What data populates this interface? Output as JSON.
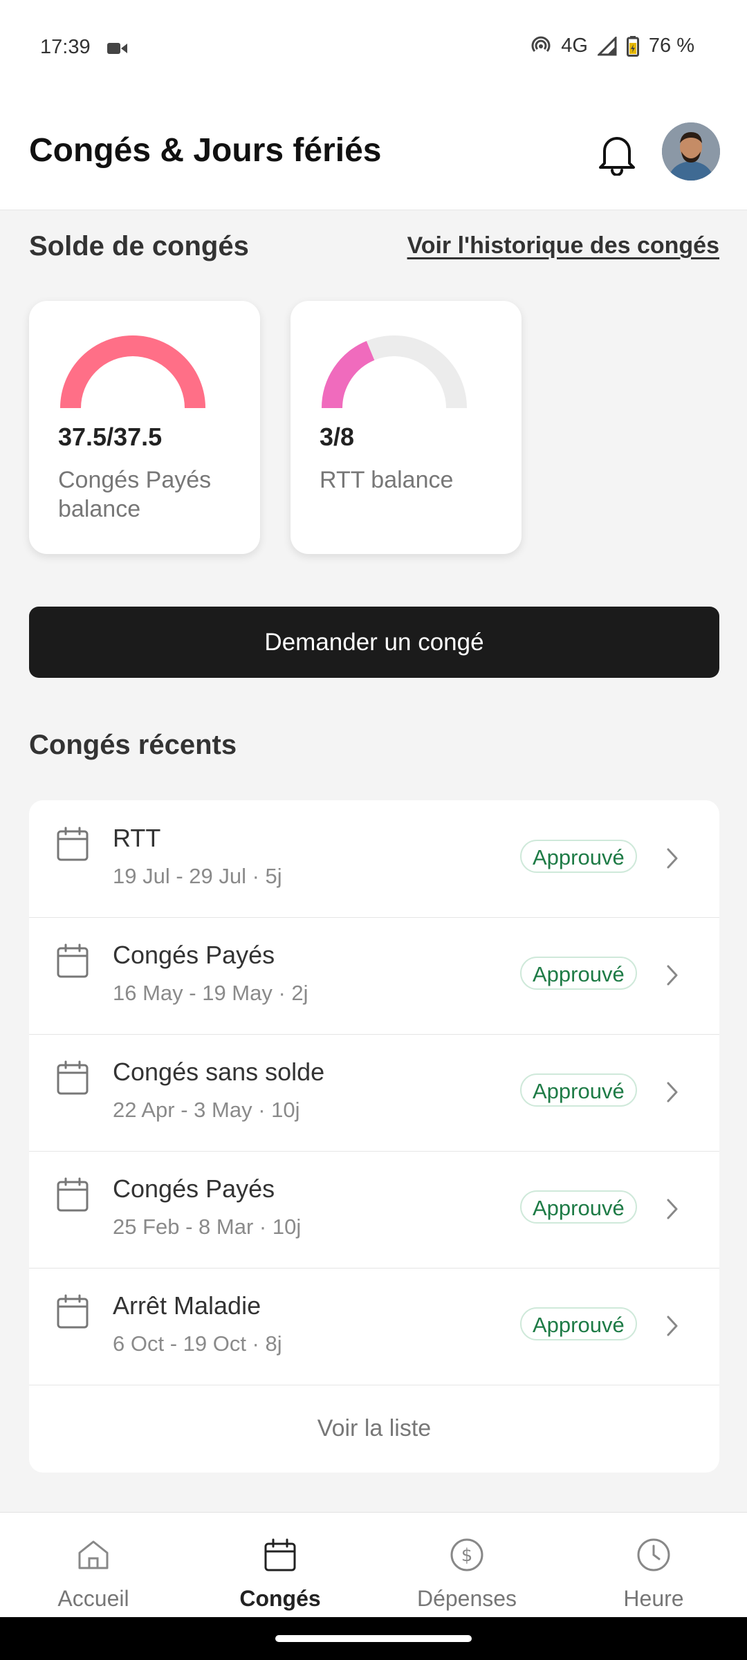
{
  "status_bar": {
    "time": "17:39",
    "network": "4G",
    "battery": "76 %"
  },
  "header": {
    "title": "Congés & Jours fériés"
  },
  "balance": {
    "section_title": "Solde de congés",
    "history_link": "Voir l'historique des congés",
    "cards": [
      {
        "value": "37.5/37.5",
        "label": "Congés Payés balance",
        "used": 37.5,
        "total": 37.5,
        "color": "#ff6f87"
      },
      {
        "value": "3/8",
        "label": "RTT balance",
        "used": 3,
        "total": 8,
        "color": "#f06bbd"
      }
    ]
  },
  "request_button": "Demander un congé",
  "recent": {
    "section_title": "Congés récents",
    "items": [
      {
        "title": "RTT",
        "subtitle": "19 Jul - 29 Jul · 5j",
        "status": "Approuvé"
      },
      {
        "title": "Congés Payés",
        "subtitle": "16 May - 19 May · 2j",
        "status": "Approuvé"
      },
      {
        "title": "Congés sans solde",
        "subtitle": "22 Apr - 3 May · 10j",
        "status": "Approuvé"
      },
      {
        "title": "Congés Payés",
        "subtitle": "25 Feb - 8 Mar · 10j",
        "status": "Approuvé"
      },
      {
        "title": "Arrêt Maladie",
        "subtitle": "6 Oct - 19 Oct · 8j",
        "status": "Approuvé"
      }
    ],
    "see_list": "Voir la liste"
  },
  "nav": [
    {
      "label": "Accueil",
      "icon": "home-icon",
      "active": false
    },
    {
      "label": "Congés",
      "icon": "calendar-icon",
      "active": true
    },
    {
      "label": "Dépenses",
      "icon": "dollar-icon",
      "active": false
    },
    {
      "label": "Heure",
      "icon": "clock-icon",
      "active": false
    }
  ]
}
